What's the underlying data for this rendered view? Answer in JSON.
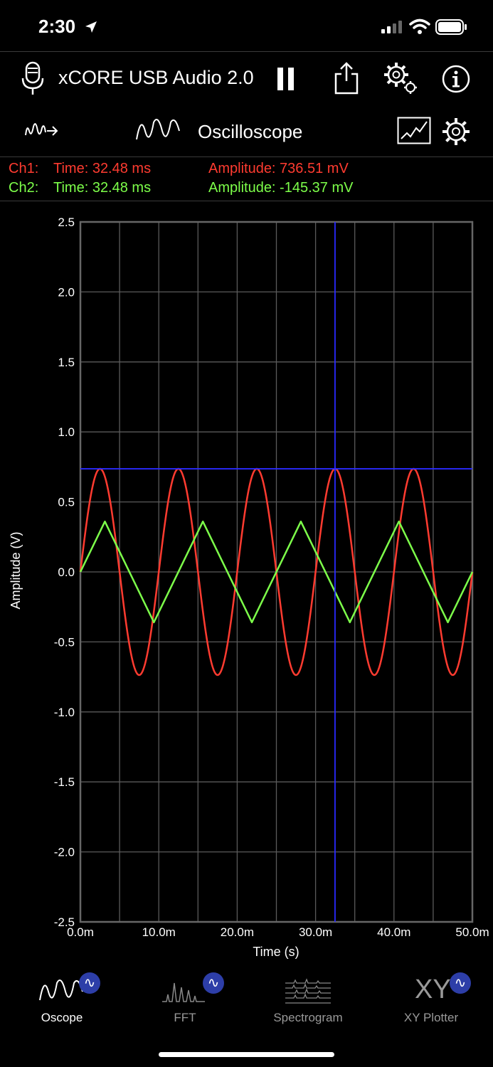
{
  "status": {
    "time": "2:30"
  },
  "header": {
    "device_name": "xCORE USB Audio 2.0"
  },
  "mode": {
    "title": "Oscilloscope"
  },
  "readout": {
    "ch1": {
      "label": "Ch1:",
      "time": "Time: 32.48 ms",
      "amplitude": "Amplitude: 736.51 mV"
    },
    "ch2": {
      "label": "Ch2:",
      "time": "Time: 32.48 ms",
      "amplitude": "Amplitude: -145.37 mV"
    }
  },
  "colors": {
    "ch1": "#ff3b30",
    "ch2": "#7dff4a",
    "cursor": "#2a2aff",
    "grid": "#5a5a5a",
    "accent_badge": "#2d3ea8"
  },
  "chart_data": {
    "type": "line",
    "xlabel": "Time (s)",
    "ylabel": "Amplitude (V)",
    "xlim": [
      0,
      0.05
    ],
    "ylim": [
      -2.5,
      2.5
    ],
    "x_ticks": [
      0,
      0.01,
      0.02,
      0.03,
      0.04,
      0.05
    ],
    "x_tick_labels": [
      "0.0m",
      "10.0m",
      "20.0m",
      "30.0m",
      "40.0m",
      "50.0m"
    ],
    "y_ticks": [
      2.5,
      2.0,
      1.5,
      1.0,
      0.5,
      0.0,
      -0.5,
      -1.0,
      -1.5,
      -2.0,
      -2.5
    ],
    "y_tick_labels": [
      "2.5",
      "2.0",
      "1.5",
      "1.0",
      "0.5",
      "0.0",
      "-0.5",
      "-1.0",
      "-1.5",
      "-2.0",
      "-2.5"
    ],
    "grid": true,
    "cursor": {
      "x": 0.03248,
      "y": 0.73651
    },
    "series": [
      {
        "waveform": "sine",
        "amplitude": 0.7365,
        "frequency_hz": 100,
        "phase_deg": 0,
        "color": "#ff3b30"
      },
      {
        "waveform": "triangle",
        "amplitude": 0.36,
        "frequency_hz": 80,
        "phase_deg": 0,
        "color": "#7dff4a"
      }
    ]
  },
  "tabs": [
    {
      "label": "Oscope",
      "active": true
    },
    {
      "label": "FFT",
      "active": false
    },
    {
      "label": "Spectrogram",
      "active": false
    },
    {
      "label": "XY Plotter",
      "active": false
    }
  ],
  "tab_badge_glyph": "∿",
  "xy_icon_text": "XY"
}
